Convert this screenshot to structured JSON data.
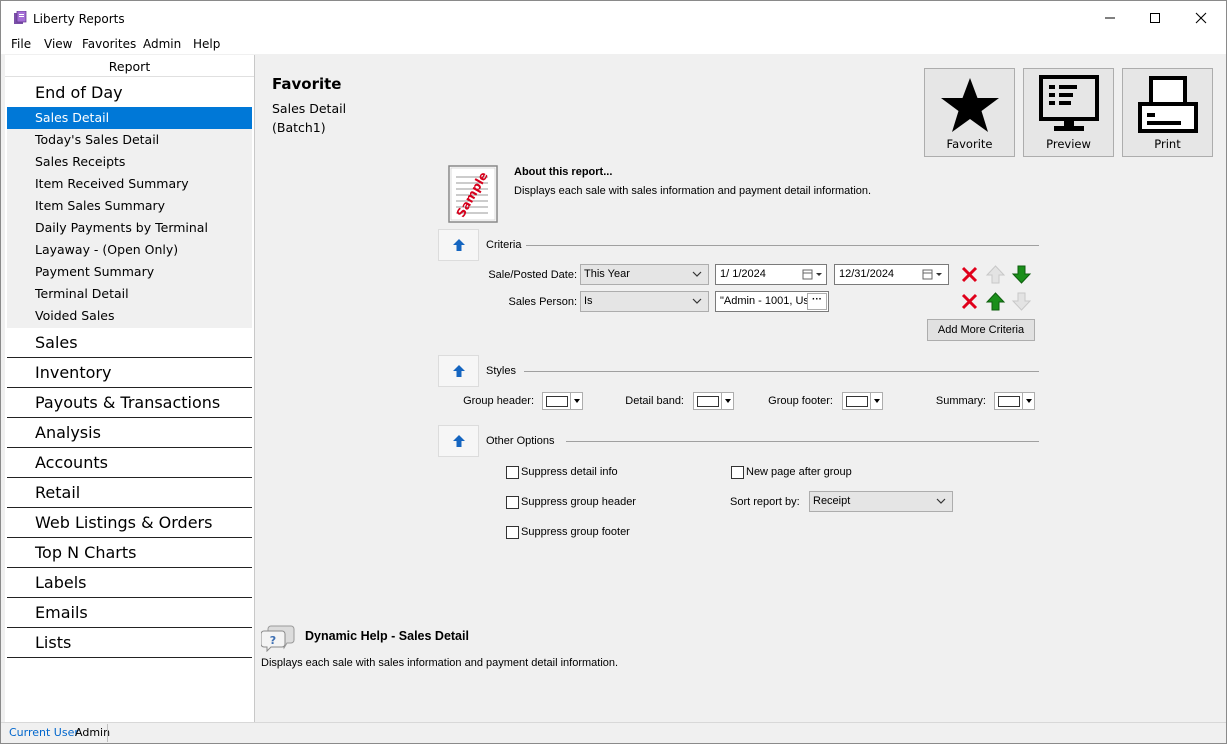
{
  "window": {
    "title": "Liberty Reports"
  },
  "menu": [
    "File",
    "View",
    "Favorites",
    "Admin",
    "Help"
  ],
  "sidebar": {
    "header": "Report",
    "open_category": "End of Day",
    "sub_items": [
      "Sales Detail",
      "Today's Sales Detail",
      "Sales Receipts",
      "Item Received Summary",
      "Item Sales Summary",
      "Daily Payments by Terminal",
      "Layaway - (Open Only)",
      "Payment Summary",
      "Terminal Detail",
      "Voided Sales"
    ],
    "selected_item": "Sales Detail",
    "categories": [
      "Sales",
      "Inventory",
      "Payouts & Transactions",
      "Analysis",
      "Accounts",
      "Retail",
      "Web Listings & Orders",
      "Top N Charts",
      "Labels",
      "Emails",
      "Lists"
    ]
  },
  "favorite": {
    "heading": "Favorite",
    "report_name": "Sales Detail",
    "batch": "(Batch1)"
  },
  "toolbar": {
    "favorite_label": "Favorite",
    "preview_label": "Preview",
    "print_label": "Print"
  },
  "about": {
    "title": "About this report...",
    "text": "Displays each sale with sales information and payment detail information.",
    "icon_text": "Sample"
  },
  "criteria": {
    "section_label": "Criteria",
    "rows": [
      {
        "label": "Sale/Posted Date:",
        "operator": "This Year",
        "from": "1/  1/2024",
        "to": "12/31/2024"
      },
      {
        "label": "Sales Person:",
        "operator": "Is",
        "value": "\"Admin - 1001, Us",
        "ellipsis": "···"
      }
    ],
    "add_more_label": "Add More Criteria"
  },
  "styles": {
    "section_label": "Styles",
    "group_header_label": "Group header:",
    "detail_band_label": "Detail band:",
    "group_footer_label": "Group footer:",
    "summary_label": "Summary:"
  },
  "other_options": {
    "section_label": "Other Options",
    "suppress_detail": "Suppress detail info",
    "suppress_group_header": "Suppress group header",
    "suppress_group_footer": "Suppress group footer",
    "new_page_after_group": "New page after group",
    "sort_label": "Sort report by:",
    "sort_value": "Receipt"
  },
  "help": {
    "title": "Dynamic Help - Sales Detail",
    "text": "Displays each sale with sales information and payment detail information."
  },
  "status": {
    "user_label": "Current User",
    "user_value": "Admin"
  },
  "colors": {
    "selection": "#0078d7",
    "delete_red": "#e0001b",
    "move_green": "#1a8f1a",
    "section_arrow_blue": "#1565c0",
    "status_label_blue": "#0066cc"
  }
}
